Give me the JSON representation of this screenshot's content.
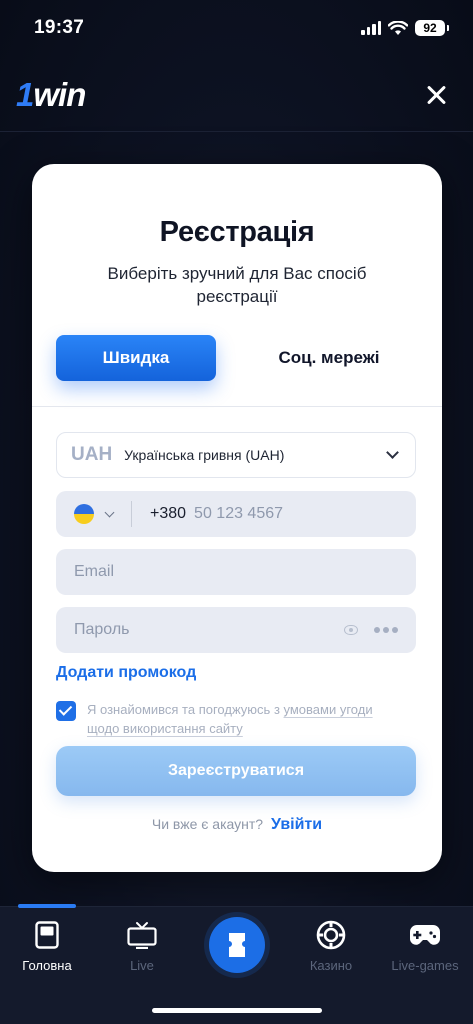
{
  "status_bar": {
    "time": "19:37",
    "battery": "92"
  },
  "header": {
    "logo_one": "1",
    "logo_win": "win"
  },
  "modal": {
    "title": "Реєстрація",
    "subtitle": "Виберіть зручний для Вас спосіб реєстрації",
    "tabs": [
      {
        "label": "Швидка",
        "active": true
      },
      {
        "label": "Соц. мережі",
        "active": false
      }
    ],
    "currency": {
      "code": "UAH",
      "name": "Українська гривня (UAH)"
    },
    "phone": {
      "country_code": "+380",
      "placeholder": "50 123 4567"
    },
    "email_placeholder": "Email",
    "password_placeholder": "Пароль",
    "promo_link": "Додати промокод",
    "terms": {
      "prefix": "Я ознайомився та погоджуюсь з ",
      "link": "умовами угоди щодо використання сайту",
      "checked": true
    },
    "submit_label": "Зареєструватися",
    "login_prompt": "Чи вже є акаунт?",
    "login_link": "Увійти"
  },
  "bottom_nav": {
    "items": [
      {
        "label": "Головна",
        "icon": "home-icon",
        "active": true
      },
      {
        "label": "Live",
        "icon": "tv-icon",
        "active": false
      },
      {
        "label": "",
        "icon": "ticket-icon",
        "active": false
      },
      {
        "label": "Казино",
        "icon": "casino-chip-icon",
        "active": false
      },
      {
        "label": "Live-games",
        "icon": "gamepad-icon",
        "active": false
      }
    ]
  },
  "colors": {
    "accent": "#1f6fe6",
    "background": "#0b1020",
    "card": "#ffffff"
  }
}
